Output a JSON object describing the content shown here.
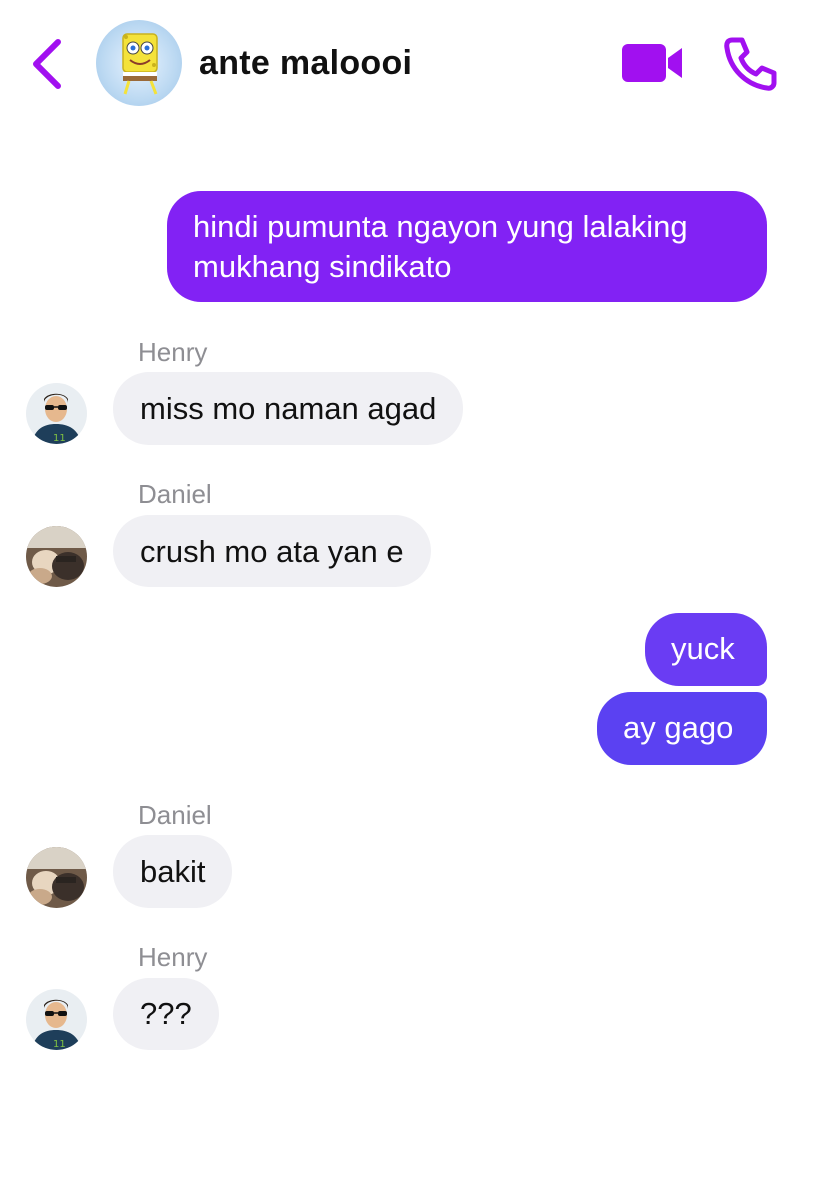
{
  "header": {
    "title": "ante maloooi",
    "accent_color": "#a110f0"
  },
  "messages": [
    {
      "type": "outgoing",
      "text_lines": [
        "hindi pumunta ngayon yung lalaking",
        "mukhang sindikato"
      ],
      "color": "#8222f4"
    },
    {
      "type": "incoming",
      "sender": "Henry",
      "text": "miss mo naman agad"
    },
    {
      "type": "incoming",
      "sender": "Daniel",
      "text": "crush mo ata yan e"
    },
    {
      "type": "outgoing",
      "text": "yuck",
      "color": "#6a3cf3"
    },
    {
      "type": "outgoing",
      "text": "ay gago",
      "color": "#5b41f2"
    },
    {
      "type": "incoming",
      "sender": "Daniel",
      "text": "bakit"
    },
    {
      "type": "incoming",
      "sender": "Henry",
      "text": "???"
    }
  ],
  "icons": {
    "back": "chevron-left-icon",
    "video": "video-camera-icon",
    "call": "phone-icon"
  }
}
